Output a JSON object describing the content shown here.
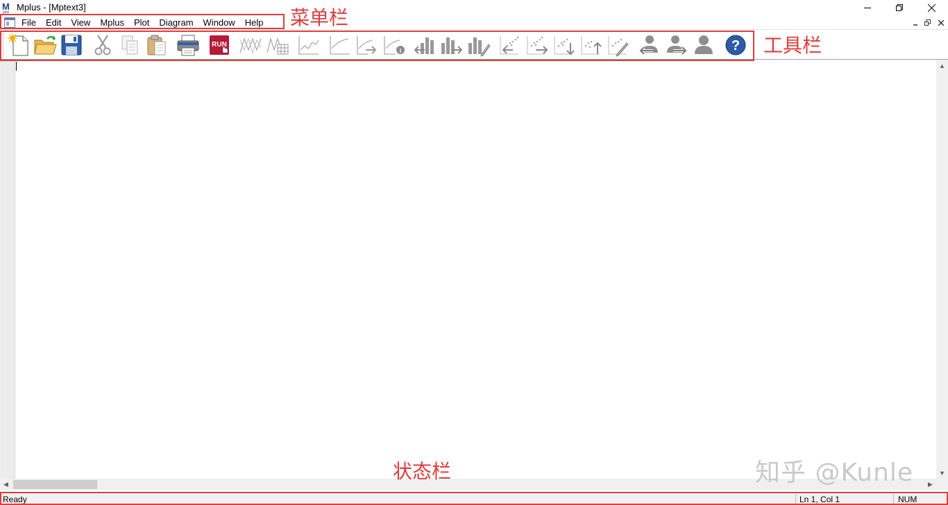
{
  "window": {
    "title": "Mplus - [Mptext3]",
    "app_icon": "mplus-logo-icon",
    "controls": [
      "minimize-icon",
      "restore-icon",
      "close-icon"
    ]
  },
  "menubar": {
    "items": [
      {
        "label": "File"
      },
      {
        "label": "Edit"
      },
      {
        "label": "View"
      },
      {
        "label": "Mplus"
      },
      {
        "label": "Plot"
      },
      {
        "label": "Diagram"
      },
      {
        "label": "Window"
      },
      {
        "label": "Help"
      }
    ],
    "mdi_controls": [
      "minimize-icon",
      "restore-icon",
      "close-icon"
    ]
  },
  "toolbar": {
    "buttons": [
      "new-file-icon",
      "open-folder-icon",
      "save-icon",
      "cut-icon",
      "copy-icon",
      "paste-icon",
      "print-icon",
      "run-icon",
      "observed-plot-icon",
      "observed-table-plot-icon",
      "line-plot-icon",
      "plot-icon",
      "plot-next-icon",
      "plot-info-icon",
      "bar-prev-icon",
      "bar-next-icon",
      "bar-edit-icon",
      "scatter-left-icon",
      "scatter-right-icon",
      "scatter-down-icon",
      "scatter-up-icon",
      "scatter-edit-icon",
      "person-prev-icon",
      "person-next-icon",
      "person-icon",
      "help-icon"
    ],
    "run_label": "RUN"
  },
  "annotations": {
    "menubar_label": "菜单栏",
    "toolbar_label": "工具栏",
    "statusbar_label": "状态栏",
    "color": "#e03c3c"
  },
  "watermark": "知乎 @Kunle",
  "status": {
    "message": "Ready",
    "position": "Ln 1, Col 1",
    "num": "NUM"
  }
}
